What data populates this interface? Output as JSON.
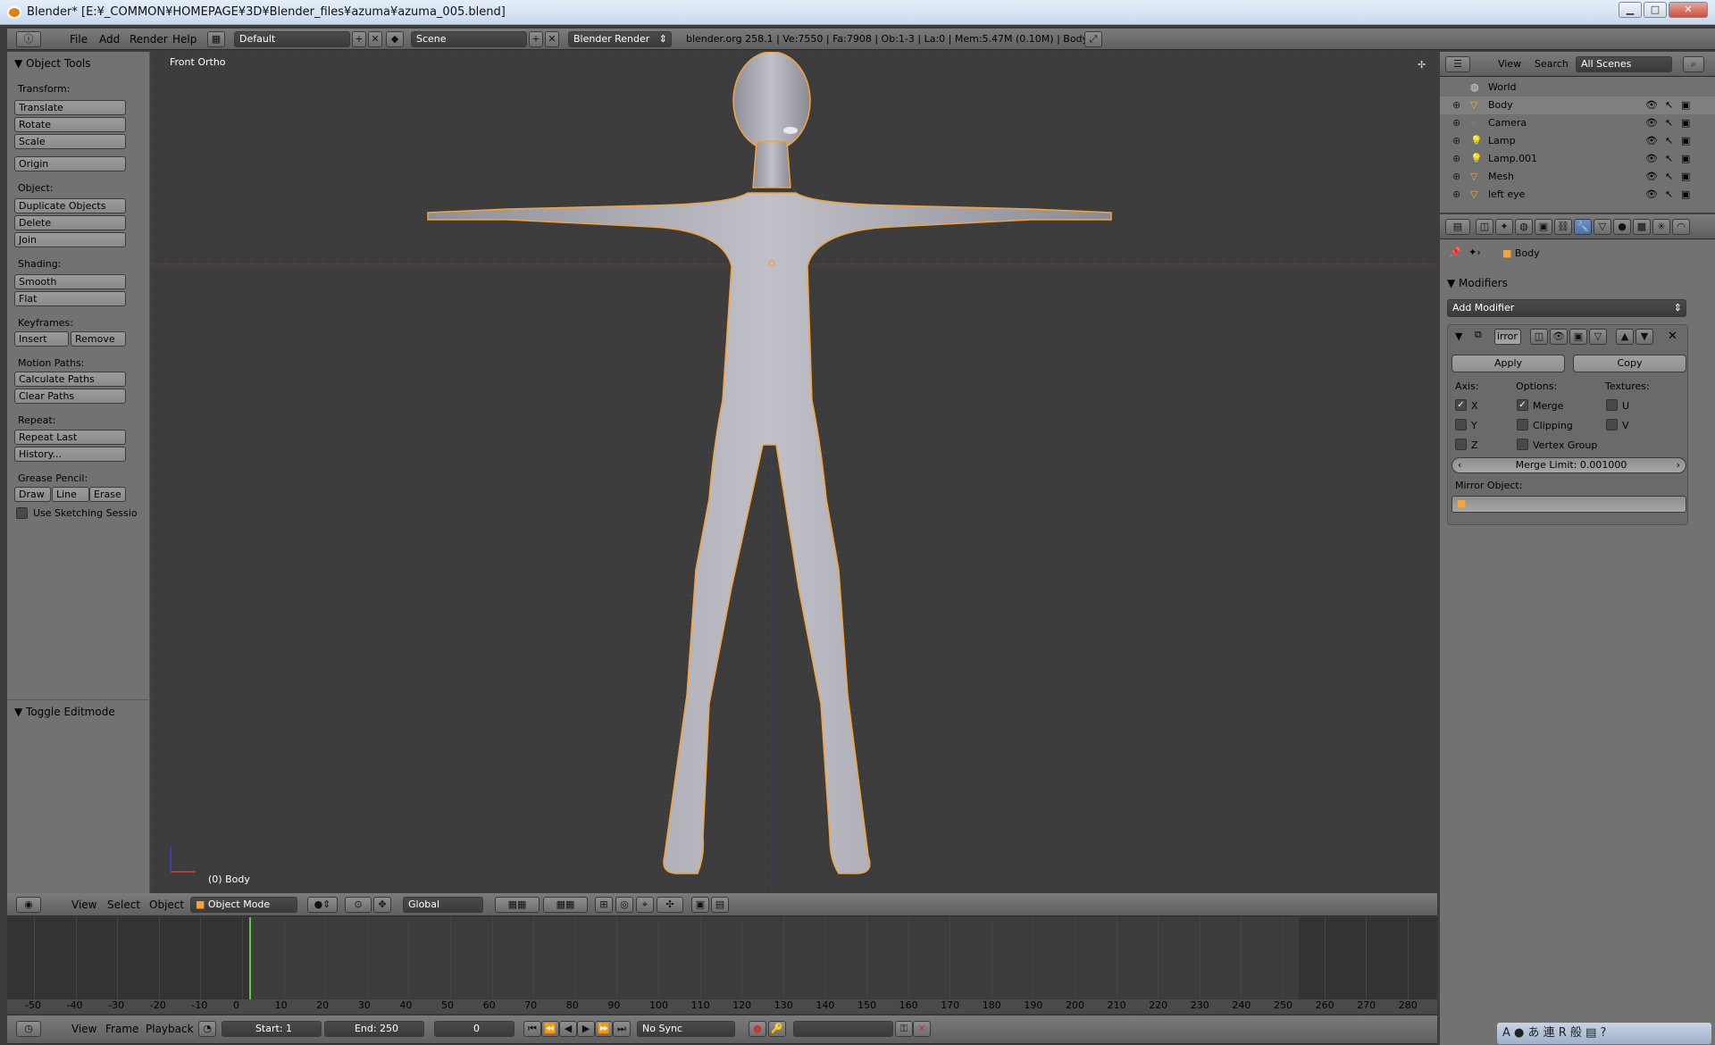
{
  "window": {
    "title": "Blender* [E:¥_COMMON¥HOMEPAGE¥3D¥Blender_files¥azuma¥azuma_005.blend]"
  },
  "topbar": {
    "menus": [
      "File",
      "Add",
      "Render",
      "Help"
    ],
    "layout_value": "Default",
    "scene_value": "Scene",
    "render_engine": "Blender Render",
    "stats": "blender.org 258.1 | Ve:7550 | Fa:7908 | Ob:1-3 | La:0 | Mem:5.47M (0.10M) | Body"
  },
  "toolshelf": {
    "panel_title": "Object Tools",
    "transform_label": "Transform:",
    "translate": "Translate",
    "rotate": "Rotate",
    "scale": "Scale",
    "origin": "Origin",
    "object_label": "Object:",
    "duplicate": "Duplicate Objects",
    "delete": "Delete",
    "join": "Join",
    "shading_label": "Shading:",
    "smooth": "Smooth",
    "flat": "Flat",
    "keyframes_label": "Keyframes:",
    "insert": "Insert",
    "remove": "Remove",
    "motion_label": "Motion Paths:",
    "calc_paths": "Calculate Paths",
    "clear_paths": "Clear Paths",
    "repeat_label": "Repeat:",
    "repeat_last": "Repeat Last",
    "history": "History...",
    "grease_label": "Grease Pencil:",
    "draw": "Draw",
    "line": "Line",
    "erase": "Erase",
    "sketching": "Use Sketching Sessio",
    "toggle_editmode": "Toggle Editmode"
  },
  "viewport": {
    "view_name": "Front Ortho",
    "object_label": "(0) Body",
    "header": {
      "menus": [
        "View",
        "Select",
        "Object"
      ],
      "mode": "Object Mode",
      "orientation": "Global"
    }
  },
  "timeline": {
    "ticks": [
      "-50",
      "-40",
      "-30",
      "-20",
      "-10",
      "0",
      "10",
      "20",
      "30",
      "40",
      "50",
      "60",
      "70",
      "80",
      "90",
      "100",
      "110",
      "120",
      "130",
      "140",
      "150",
      "160",
      "170",
      "180",
      "190",
      "200",
      "210",
      "220",
      "230",
      "240",
      "250",
      "260",
      "270",
      "280"
    ],
    "current_frame_marker": 0,
    "menus": [
      "View",
      "Frame",
      "Playback"
    ],
    "start": "Start: 1",
    "end": "End: 250",
    "frame": "0",
    "sync": "No Sync"
  },
  "outliner": {
    "menus": [
      "View",
      "Search"
    ],
    "scenes": "All Scenes",
    "items": [
      {
        "name": "World"
      },
      {
        "name": "Body"
      },
      {
        "name": "Camera"
      },
      {
        "name": "Lamp"
      },
      {
        "name": "Lamp.001"
      },
      {
        "name": "Mesh"
      },
      {
        "name": "left eye"
      }
    ]
  },
  "properties": {
    "breadcrumb": "Body",
    "section": "Modifiers",
    "add_modifier": "Add Modifier",
    "modifier_name": "irror",
    "apply": "Apply",
    "copy": "Copy",
    "axis_label": "Axis:",
    "options_label": "Options:",
    "textures_label": "Textures:",
    "x": "X",
    "y": "Y",
    "z": "Z",
    "merge": "Merge",
    "clipping": "Clipping",
    "vertex_group": "Vertex Group",
    "u": "U",
    "v": "V",
    "merge_limit": "Merge Limit: 0.001000",
    "mirror_object": "Mirror Object:"
  },
  "colors": {
    "accent_orange": "#f5a33c",
    "frame_green": "#59c84a",
    "selection_outline": "#f7a23a"
  }
}
